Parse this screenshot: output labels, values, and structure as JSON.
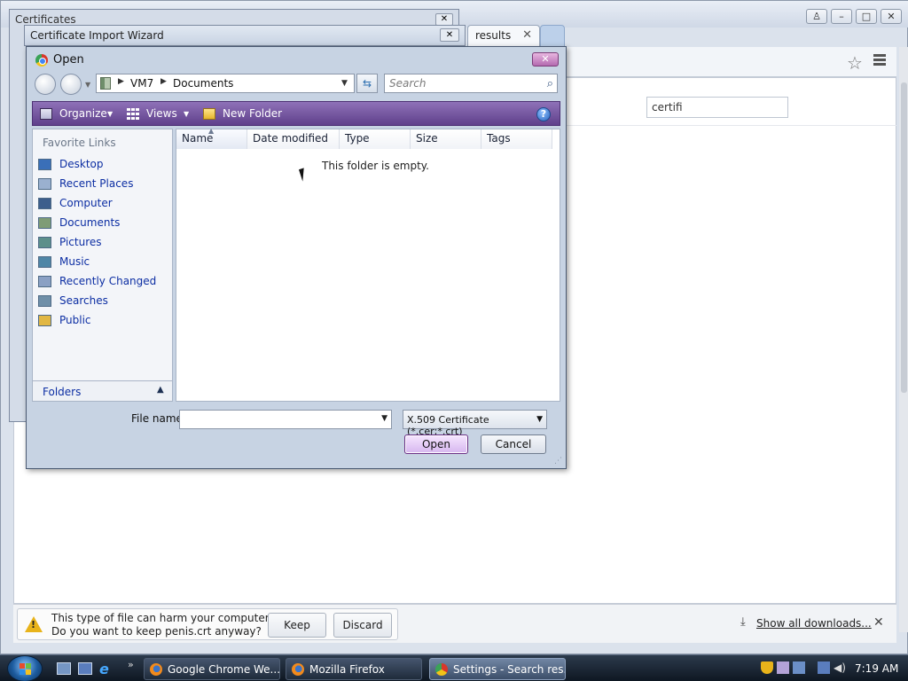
{
  "chrome": {
    "tab_results_label": "results",
    "tab_close": "✕",
    "search_value": "certifi"
  },
  "cert_window": {
    "title": "Certificates",
    "close": "✕"
  },
  "wizard": {
    "title": "Certificate Import Wizard",
    "close": "✕"
  },
  "dialog": {
    "title": "Open",
    "close": "✕",
    "address": {
      "crumbs": [
        "VM7",
        "Documents"
      ]
    },
    "search_placeholder": "Search",
    "toolbar": {
      "organize": "Organize",
      "views": "Views",
      "new_folder": "New Folder",
      "help": "?"
    },
    "nav": {
      "header": "Favorite Links",
      "items": [
        {
          "label": "Desktop",
          "color": "#3a6fb8"
        },
        {
          "label": "Recent Places",
          "color": "#9ab0cf"
        },
        {
          "label": "Computer",
          "color": "#3d5e8c"
        },
        {
          "label": "Documents",
          "color": "#7f9c76"
        },
        {
          "label": "Pictures",
          "color": "#5c8f8a"
        },
        {
          "label": "Music",
          "color": "#4f86a6"
        },
        {
          "label": "Recently Changed",
          "color": "#8aa0c4"
        },
        {
          "label": "Searches",
          "color": "#6f8fa8"
        },
        {
          "label": "Public",
          "color": "#e1b743"
        }
      ],
      "folders_label": "Folders"
    },
    "columns": [
      "Name",
      "Date modified",
      "Type",
      "Size",
      "Tags"
    ],
    "empty_message": "This folder is empty.",
    "file_name_label": "File name:",
    "file_name_value": "",
    "file_type": "X.509 Certificate (*.cer;*.crt)",
    "open_button": "Open",
    "cancel_button": "Cancel"
  },
  "download_bar": {
    "warning_line1": "This type of file can harm your computer.",
    "warning_line2": "Do you want to keep penis.crt anyway?",
    "keep": "Keep",
    "discard": "Discard",
    "show_all": "Show all downloads...",
    "close": "✕"
  },
  "taskbar": {
    "quicklaunch_more": "»",
    "tasks": [
      {
        "label": "Google Chrome We...",
        "icon": "firefox-icon"
      },
      {
        "label": "Mozilla Firefox",
        "icon": "firefox-icon"
      },
      {
        "label": "Settings - Search res...",
        "icon": "chrome-icon"
      }
    ],
    "clock": "7:19 AM"
  }
}
